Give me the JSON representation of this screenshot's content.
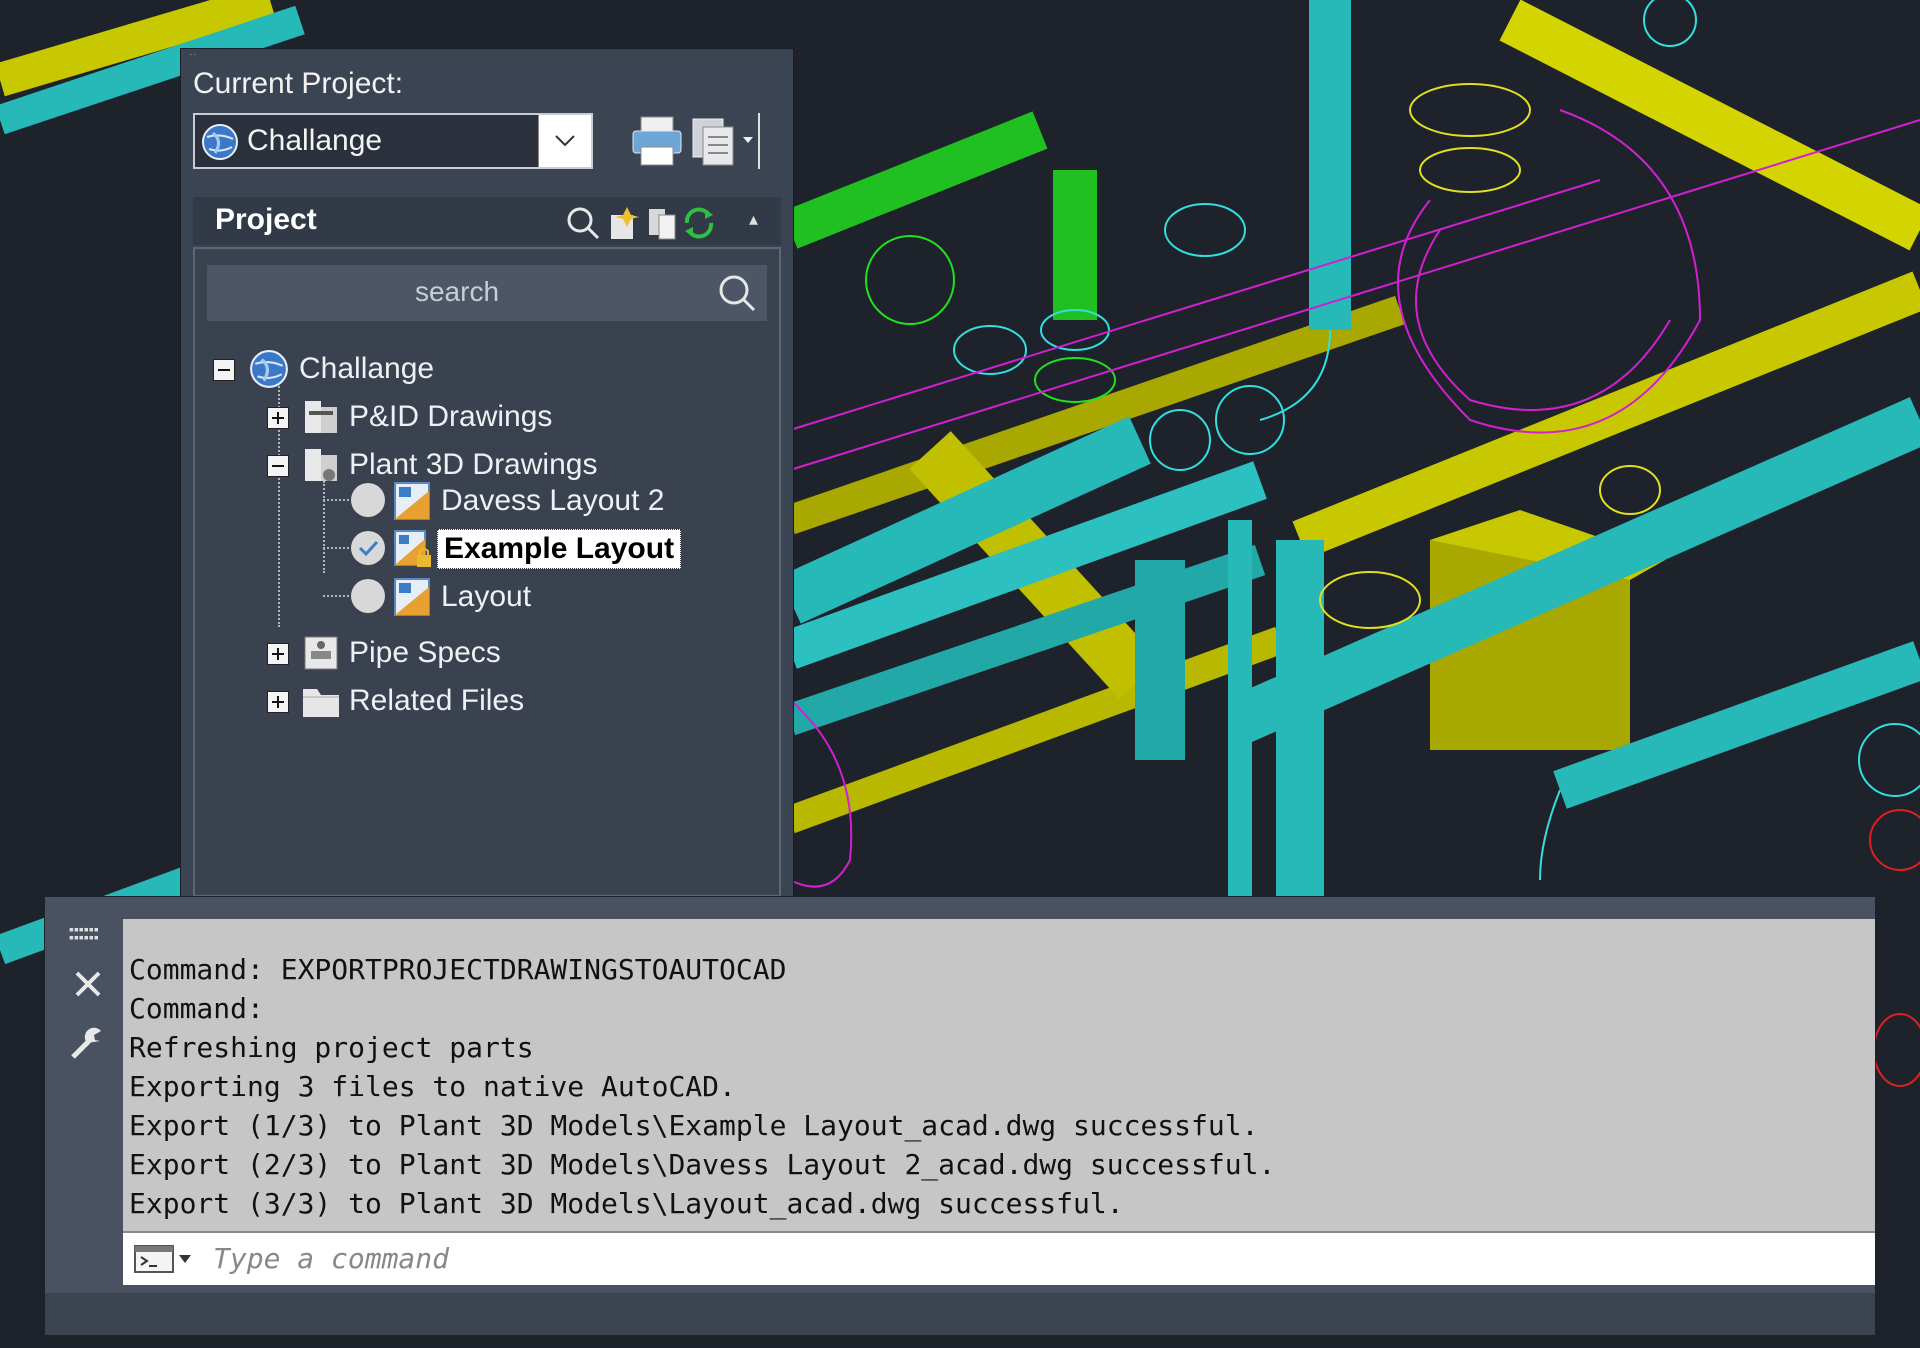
{
  "project_manager": {
    "current_project_label": "Current Project:",
    "selected_project": "Challange",
    "header_title": "Project",
    "search_placeholder": "search",
    "tree": {
      "root": "Challange",
      "pid_drawings": "P&ID Drawings",
      "plant3d_drawings": "Plant 3D Drawings",
      "drawing_1": "Davess Layout 2",
      "drawing_2": "Example Layout",
      "drawing_3": "Layout",
      "pipe_specs": "Pipe Specs",
      "related_files": "Related Files"
    }
  },
  "command_window": {
    "history": [
      "Command: EXPORTPROJECTDRAWINGSTOAUTOCAD",
      "Command:",
      "Refreshing project parts",
      "Exporting 3 files to native AutoCAD.",
      "Export (1/3) to Plant 3D Models\\Example Layout_acad.dwg successful.",
      "Export (2/3) to Plant 3D Models\\Davess Layout 2_acad.dwg successful.",
      "Export (3/3) to Plant 3D Models\\Layout_acad.dwg successful."
    ],
    "input_placeholder": "Type a command"
  },
  "colors": {
    "viewport_bg": "#1e222b",
    "pipe_cyan": "#27b8b8",
    "pipe_yellow": "#c8c800",
    "pipe_green": "#20c020",
    "wire_magenta": "#d020d0",
    "wire_cyan": "#30e0e0",
    "wire_red": "#e02020"
  }
}
